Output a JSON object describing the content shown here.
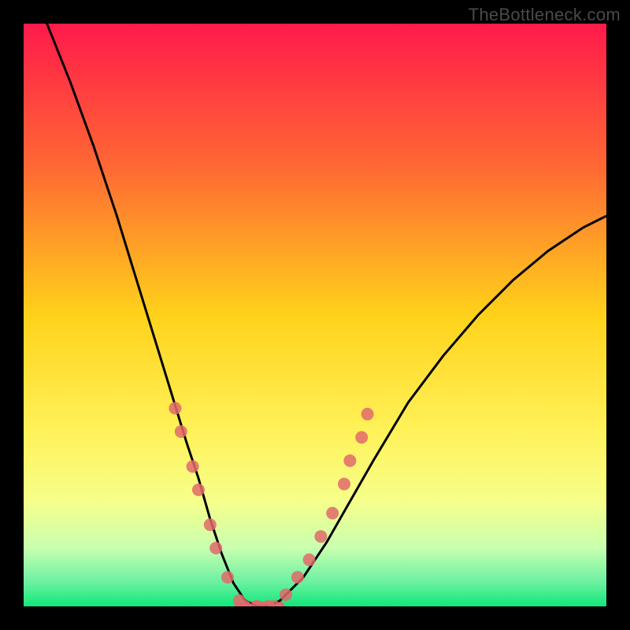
{
  "watermark": "TheBottleneck.com",
  "chart_data": {
    "type": "line",
    "title": "",
    "xlabel": "",
    "ylabel": "",
    "xlim": [
      0,
      100
    ],
    "ylim": [
      0,
      100
    ],
    "gradient_stops": [
      {
        "offset": 0,
        "color": "#ff1a4b"
      },
      {
        "offset": 25,
        "color": "#ff6a33"
      },
      {
        "offset": 50,
        "color": "#ffd21a"
      },
      {
        "offset": 70,
        "color": "#fff25a"
      },
      {
        "offset": 82,
        "color": "#f6ff8a"
      },
      {
        "offset": 90,
        "color": "#c8ffb0"
      },
      {
        "offset": 96,
        "color": "#68f0a0"
      },
      {
        "offset": 100,
        "color": "#10e87a"
      }
    ],
    "series": [
      {
        "name": "bottleneck-curve",
        "color": "#000000",
        "x": [
          0,
          4,
          8,
          12,
          16,
          20,
          24,
          28,
          30,
          32,
          34,
          36,
          38,
          40,
          42,
          44,
          48,
          52,
          56,
          60,
          66,
          72,
          78,
          84,
          90,
          96,
          100
        ],
        "y": [
          108,
          100,
          90,
          79,
          67,
          54,
          41,
          28,
          22,
          15,
          9,
          4,
          1,
          0,
          0,
          1,
          5,
          11,
          18,
          25,
          35,
          43,
          50,
          56,
          61,
          65,
          67
        ]
      }
    ],
    "markers": {
      "name": "datapoints",
      "color": "#e16a6a",
      "opacity": 0.85,
      "radius": 8,
      "points": [
        {
          "x": 26,
          "y": 34
        },
        {
          "x": 27,
          "y": 30
        },
        {
          "x": 29,
          "y": 24
        },
        {
          "x": 30,
          "y": 20
        },
        {
          "x": 32,
          "y": 14
        },
        {
          "x": 33,
          "y": 10
        },
        {
          "x": 35,
          "y": 5
        },
        {
          "x": 37,
          "y": 1
        },
        {
          "x": 38,
          "y": 0
        },
        {
          "x": 40,
          "y": 0
        },
        {
          "x": 42,
          "y": 0
        },
        {
          "x": 43,
          "y": 0
        },
        {
          "x": 45,
          "y": 2
        },
        {
          "x": 47,
          "y": 5
        },
        {
          "x": 49,
          "y": 8
        },
        {
          "x": 51,
          "y": 12
        },
        {
          "x": 53,
          "y": 16
        },
        {
          "x": 55,
          "y": 21
        },
        {
          "x": 56,
          "y": 25
        },
        {
          "x": 58,
          "y": 29
        },
        {
          "x": 59,
          "y": 33
        }
      ]
    },
    "flat_segment": {
      "x0": 37,
      "x1": 44,
      "y": 0,
      "color": "#e16a6a",
      "thickness": 12
    }
  }
}
